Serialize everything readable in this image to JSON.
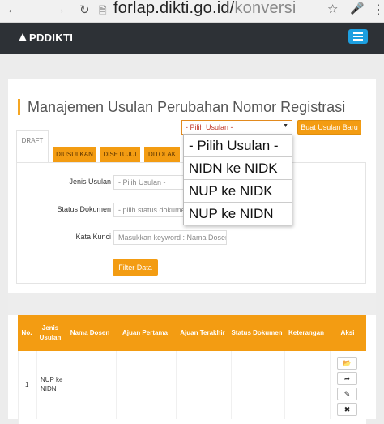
{
  "browser": {
    "url_domain": "forlap.dikti.go.id/",
    "url_path": "konversi"
  },
  "navbar": {
    "brand": "PDDIKTI"
  },
  "page": {
    "title": "Manajemen Usulan Perubahan Nomor Registrasi",
    "usulan_select_value": "- Pilih Usulan -",
    "create_button": "Buat Usulan Baru"
  },
  "tabs": [
    {
      "label": "DRAFT"
    },
    {
      "label": "DIUSULKAN"
    },
    {
      "label": "DISETUJUI"
    },
    {
      "label": "DITOLAK"
    }
  ],
  "filter": {
    "jenis_label": "Jenis Usulan",
    "jenis_value": "- Pilih Usulan -",
    "status_label": "Status Dokumen",
    "status_value": "- pilih status dokumen",
    "kata_label": "Kata Kunci",
    "kata_placeholder": "Masukkan keyword : Nama Dosen",
    "filter_button": "Filter Data"
  },
  "table": {
    "headers": [
      "No.",
      "Jenis Usulan",
      "Nama Dosen",
      "Ajuan Pertama",
      "Ajuan Terakhir",
      "Status Dokumen",
      "Keterangan",
      "Aksi"
    ],
    "rows": [
      {
        "no": "1",
        "jenis": "NUP ke NIDN"
      }
    ]
  },
  "dropdown": {
    "options": [
      "- Pilih Usulan -",
      "NIDN ke NIDK",
      "NUP ke NIDK",
      "NUP ke NIDN"
    ]
  }
}
